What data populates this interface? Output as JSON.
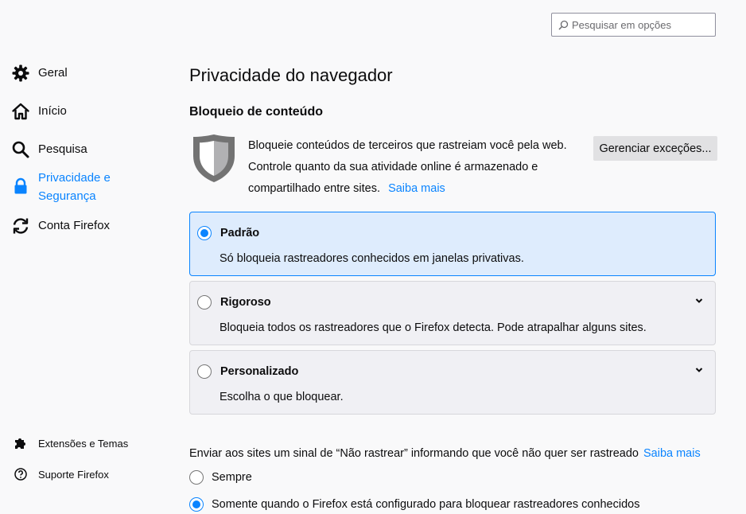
{
  "search": {
    "placeholder": "Pesquisar em opções",
    "icon": "search-icon"
  },
  "sidebar": {
    "items": [
      {
        "label": "Geral",
        "icon": "gear-icon"
      },
      {
        "label": "Início",
        "icon": "home-icon"
      },
      {
        "label": "Pesquisa",
        "icon": "search-icon"
      },
      {
        "label": "Privacidade e Segurança",
        "icon": "lock-icon",
        "selected": true
      },
      {
        "label": "Conta Firefox",
        "icon": "sync-icon"
      }
    ],
    "footer": [
      {
        "label": "Extensões e Temas",
        "icon": "puzzle-icon"
      },
      {
        "label": "Suporte Firefox",
        "icon": "help-icon"
      }
    ]
  },
  "main": {
    "title": "Privacidade do navegador",
    "content_blocking": {
      "heading": "Bloqueio de conteúdo",
      "description": "Bloqueie conteúdos de terceiros que rastreiam você pela web. Controle quanto da sua atividade online é armazenado e compartilhado entre sites.",
      "learn_more": "Saiba mais",
      "manage_button": "Gerenciar exceções...",
      "options": [
        {
          "title": "Padrão",
          "desc": "Só bloqueia rastreadores conhecidos em janelas privativas.",
          "selected": true
        },
        {
          "title": "Rigoroso",
          "desc": "Bloqueia todos os rastreadores que o Firefox detecta. Pode atrapalhar alguns sites.",
          "selected": false
        },
        {
          "title": "Personalizado",
          "desc": "Escolha o que bloquear.",
          "selected": false
        }
      ]
    },
    "dnt": {
      "label": "Enviar aos sites um sinal de “Não rastrear” informando que você não quer ser rastreado",
      "learn_more": "Saiba mais",
      "options": [
        {
          "label": "Sempre",
          "selected": false
        },
        {
          "label": "Somente quando o Firefox está configurado para bloquear rastreadores conhecidos",
          "selected": true
        }
      ]
    }
  },
  "colors": {
    "accent": "#0a84ff",
    "selected_card": "#deecfd",
    "background": "#f9f9fa"
  }
}
